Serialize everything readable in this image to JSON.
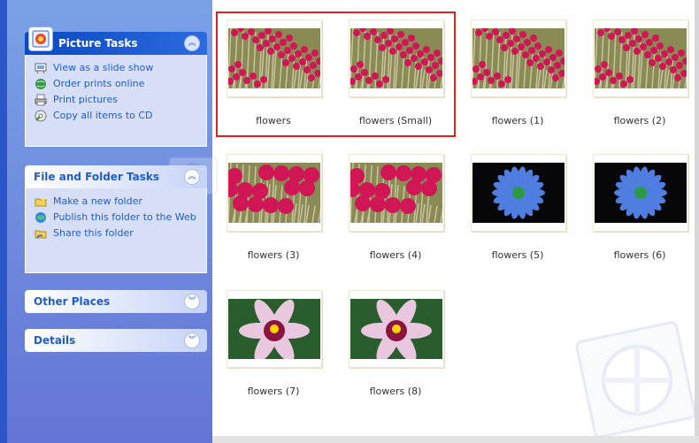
{
  "picture_tasks": {
    "title": "Picture Tasks",
    "items": [
      {
        "label": "View as a slide show",
        "icon": "slideshow-icon"
      },
      {
        "label": "Order prints online",
        "icon": "globe-icon"
      },
      {
        "label": "Print pictures",
        "icon": "printer-icon"
      },
      {
        "label": "Copy all items to CD",
        "icon": "cd-icon"
      }
    ]
  },
  "file_folder_tasks": {
    "title": "File and Folder Tasks",
    "items": [
      {
        "label": "Make a new folder",
        "icon": "new-folder-icon"
      },
      {
        "label": "Publish this folder to the Web",
        "icon": "publish-web-icon"
      },
      {
        "label": "Share this folder",
        "icon": "share-folder-icon"
      }
    ]
  },
  "other_places": {
    "title": "Other Places"
  },
  "details": {
    "title": "Details"
  },
  "files": [
    {
      "name": "flowers",
      "kind": "red"
    },
    {
      "name": "flowers (Small)",
      "kind": "red"
    },
    {
      "name": "flowers (1)",
      "kind": "red"
    },
    {
      "name": "flowers (2)",
      "kind": "red"
    },
    {
      "name": "flowers (3)",
      "kind": "red-close"
    },
    {
      "name": "flowers (4)",
      "kind": "red-close"
    },
    {
      "name": "flowers (5)",
      "kind": "blue"
    },
    {
      "name": "flowers (6)",
      "kind": "blue"
    },
    {
      "name": "flowers (7)",
      "kind": "pink"
    },
    {
      "name": "flowers (8)",
      "kind": "pink"
    }
  ],
  "colors": {
    "task_pane_top": "#7aa1e6",
    "task_link": "#215dc6",
    "selection": "#e2231b"
  }
}
